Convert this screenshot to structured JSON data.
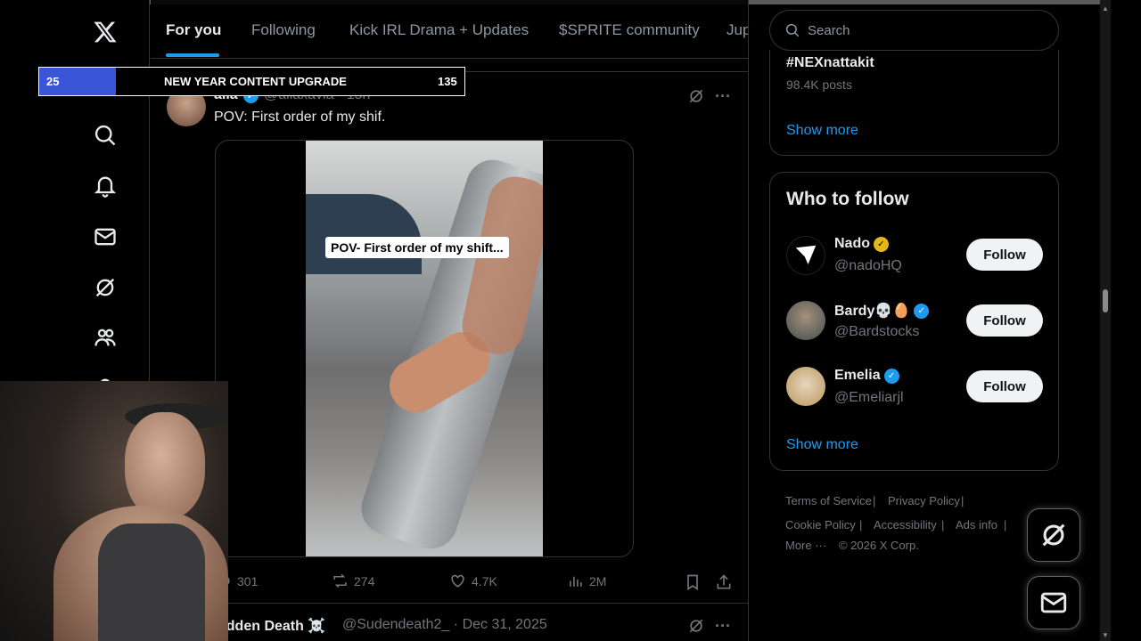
{
  "tabs": [
    "For you",
    "Following",
    "Kick IRL Drama + Updates",
    "$SPRITE community",
    "Jup"
  ],
  "overlay": {
    "left_count": "25",
    "title": "NEW YEAR CONTENT UPGRADE",
    "right_count": "135",
    "progress_fraction": 0.18
  },
  "post": {
    "name": "aila",
    "handle": "@ailaxavia · 15h",
    "text": "POV: First order of my shif.",
    "video_caption": "POV- First order of my shift...",
    "stats": {
      "replies": "301",
      "reposts": "274",
      "likes": "4.7K",
      "views": "2M"
    }
  },
  "next_post": {
    "name": "udden Death ☠️",
    "meta": "@Sudendeath2_ · Dec 31, 2025"
  },
  "search": {
    "placeholder": "Search"
  },
  "trend": {
    "tag": "#NEXnattakit",
    "count": "98.4K posts",
    "show_more": "Show more"
  },
  "who_to_follow": {
    "title": "Who to follow",
    "users": [
      {
        "name": "Nado",
        "handle": "@nadoHQ",
        "button": "Follow",
        "badge": "gold"
      },
      {
        "name": "Bardy💀🥚",
        "handle": "@Bardstocks",
        "button": "Follow",
        "badge": "blue"
      },
      {
        "name": "Emelia",
        "handle": "@Emeliarjl",
        "button": "Follow",
        "badge": "blue"
      }
    ],
    "show_more": "Show more"
  },
  "footer": {
    "links": [
      "Terms of Service",
      "Privacy Policy",
      "Cookie Policy",
      "Accessibility",
      "Ads info",
      "More ···"
    ],
    "copyright": "© 2026 X Corp."
  },
  "colors": {
    "accent": "#1d9bf0",
    "background": "#000000",
    "progress": "#3a55d8",
    "gold_badge": "#e2b719"
  }
}
